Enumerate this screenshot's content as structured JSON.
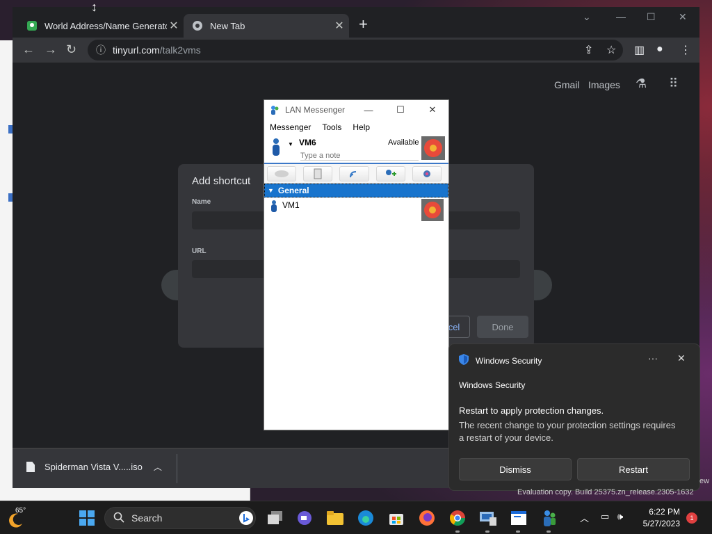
{
  "browser": {
    "tabs": [
      {
        "title": "World Address/Name Generator",
        "close": "✕"
      },
      {
        "title": "New Tab",
        "close": "✕"
      }
    ],
    "new_tab": "+",
    "address": {
      "host": "tinyurl.com",
      "path": "/talk2vms"
    },
    "links": {
      "gmail": "Gmail",
      "images": "Images"
    }
  },
  "dialog": {
    "title": "Add shortcut",
    "name_label": "Name",
    "url_label": "URL",
    "cancel_label": "cel",
    "done_label": "Done"
  },
  "download": {
    "filename": "Spiderman Vista V.....iso"
  },
  "lan": {
    "title": "LAN Messenger",
    "menu": [
      "Messenger",
      "Tools",
      "Help"
    ],
    "user": {
      "name": "VM6",
      "status": "Available",
      "note_placeholder": "Type a note"
    },
    "group": "General",
    "contacts": [
      {
        "name": "VM1"
      }
    ]
  },
  "toast": {
    "app": "Windows Security",
    "subtitle": "Windows Security",
    "heading": "Restart to apply protection changes.",
    "body": "The recent change to your protection settings requires a restart of your device.",
    "dismiss": "Dismiss",
    "restart": "Restart",
    "more": "···",
    "close": "✕"
  },
  "watermark": {
    "line": "Evaluation copy. Build 25375.zn_release.2305-1632",
    "edge": "ew"
  },
  "taskbar": {
    "weather_temp": "65°",
    "search_label": "Search",
    "time": "6:22 PM",
    "date": "5/27/2023",
    "notifications": "1"
  },
  "colors": {
    "accent": "#1874cd",
    "chrome_bg": "#202124",
    "toast_bg": "#2b2b2b"
  }
}
